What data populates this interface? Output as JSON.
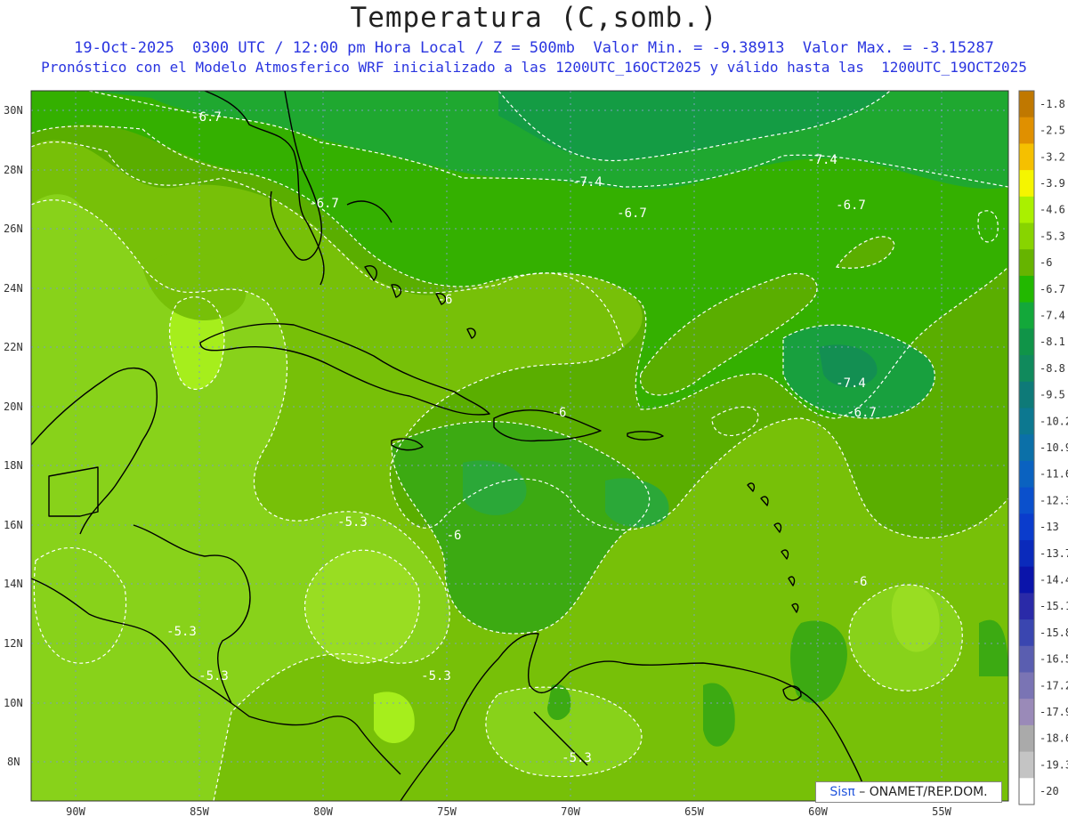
{
  "header": {
    "title": "Temperatura (C,somb.)",
    "line1": "19-Oct-2025  0300 UTC / 12:00 pm Hora Local / Z = 500mb  Valor Min. = -9.38913  Valor Max. = -3.15287",
    "line2": "Pronóstico con el Modelo Atmosferico WRF inicializado a las 1200UTC_16OCT2025 y válido hasta las  1200UTC_19OCT2025"
  },
  "axes": {
    "lat_labels": [
      "30N",
      "28N",
      "26N",
      "24N",
      "22N",
      "20N",
      "18N",
      "16N",
      "14N",
      "12N",
      "10N",
      "8N"
    ],
    "lon_labels": [
      "90W",
      "85W",
      "80W",
      "75W",
      "70W",
      "65W",
      "60W",
      "55W"
    ]
  },
  "colorbar": {
    "labels": [
      "-1.8",
      "-2.5",
      "-3.2",
      "-3.9",
      "-4.6",
      "-5.3",
      "-6",
      "-6.7",
      "-7.4",
      "-8.1",
      "-8.8",
      "-9.5",
      "-10.2",
      "-10.9",
      "-11.6",
      "-12.3",
      "-13",
      "-13.7",
      "-14.4",
      "-15.1",
      "-15.8",
      "-16.5",
      "-17.2",
      "-17.9",
      "-18.6",
      "-19.3",
      "-20"
    ],
    "colors": [
      "#c07800",
      "#e09000",
      "#f5c000",
      "#f5f500",
      "#aaf000",
      "#88d400",
      "#66b400",
      "#22b800",
      "#13a83a",
      "#109448",
      "#108a5c",
      "#0e7a78",
      "#0c7890",
      "#0b70a8",
      "#0a62c0",
      "#0a50cc",
      "#0a3ccc",
      "#0a2abb",
      "#0a14aa",
      "#2a2aa8",
      "#3a46b0",
      "#5a5eb0",
      "#7a74b4",
      "#9a8ab8",
      "#aaaaaa",
      "#c4c4c4",
      "#ffffff"
    ]
  },
  "contour_labels": [
    "-6.7",
    "-7.4",
    "-6.7",
    "-7.4",
    "-6.7",
    "-6.7",
    "-6",
    "-6",
    "-7.4",
    "-6.7",
    "-5.3",
    "-6",
    "-6",
    "-5.3",
    "-5.3",
    "-5.3",
    "-5.3"
  ],
  "credit": {
    "brand": "Sisπ",
    "org": " – ONAMET/REP.DOM."
  },
  "colors": {
    "title": "#222222",
    "subtitle": "#2a35e0",
    "contour": "#ffffff",
    "coast": "#000000",
    "grid": "#7a9fbf"
  }
}
